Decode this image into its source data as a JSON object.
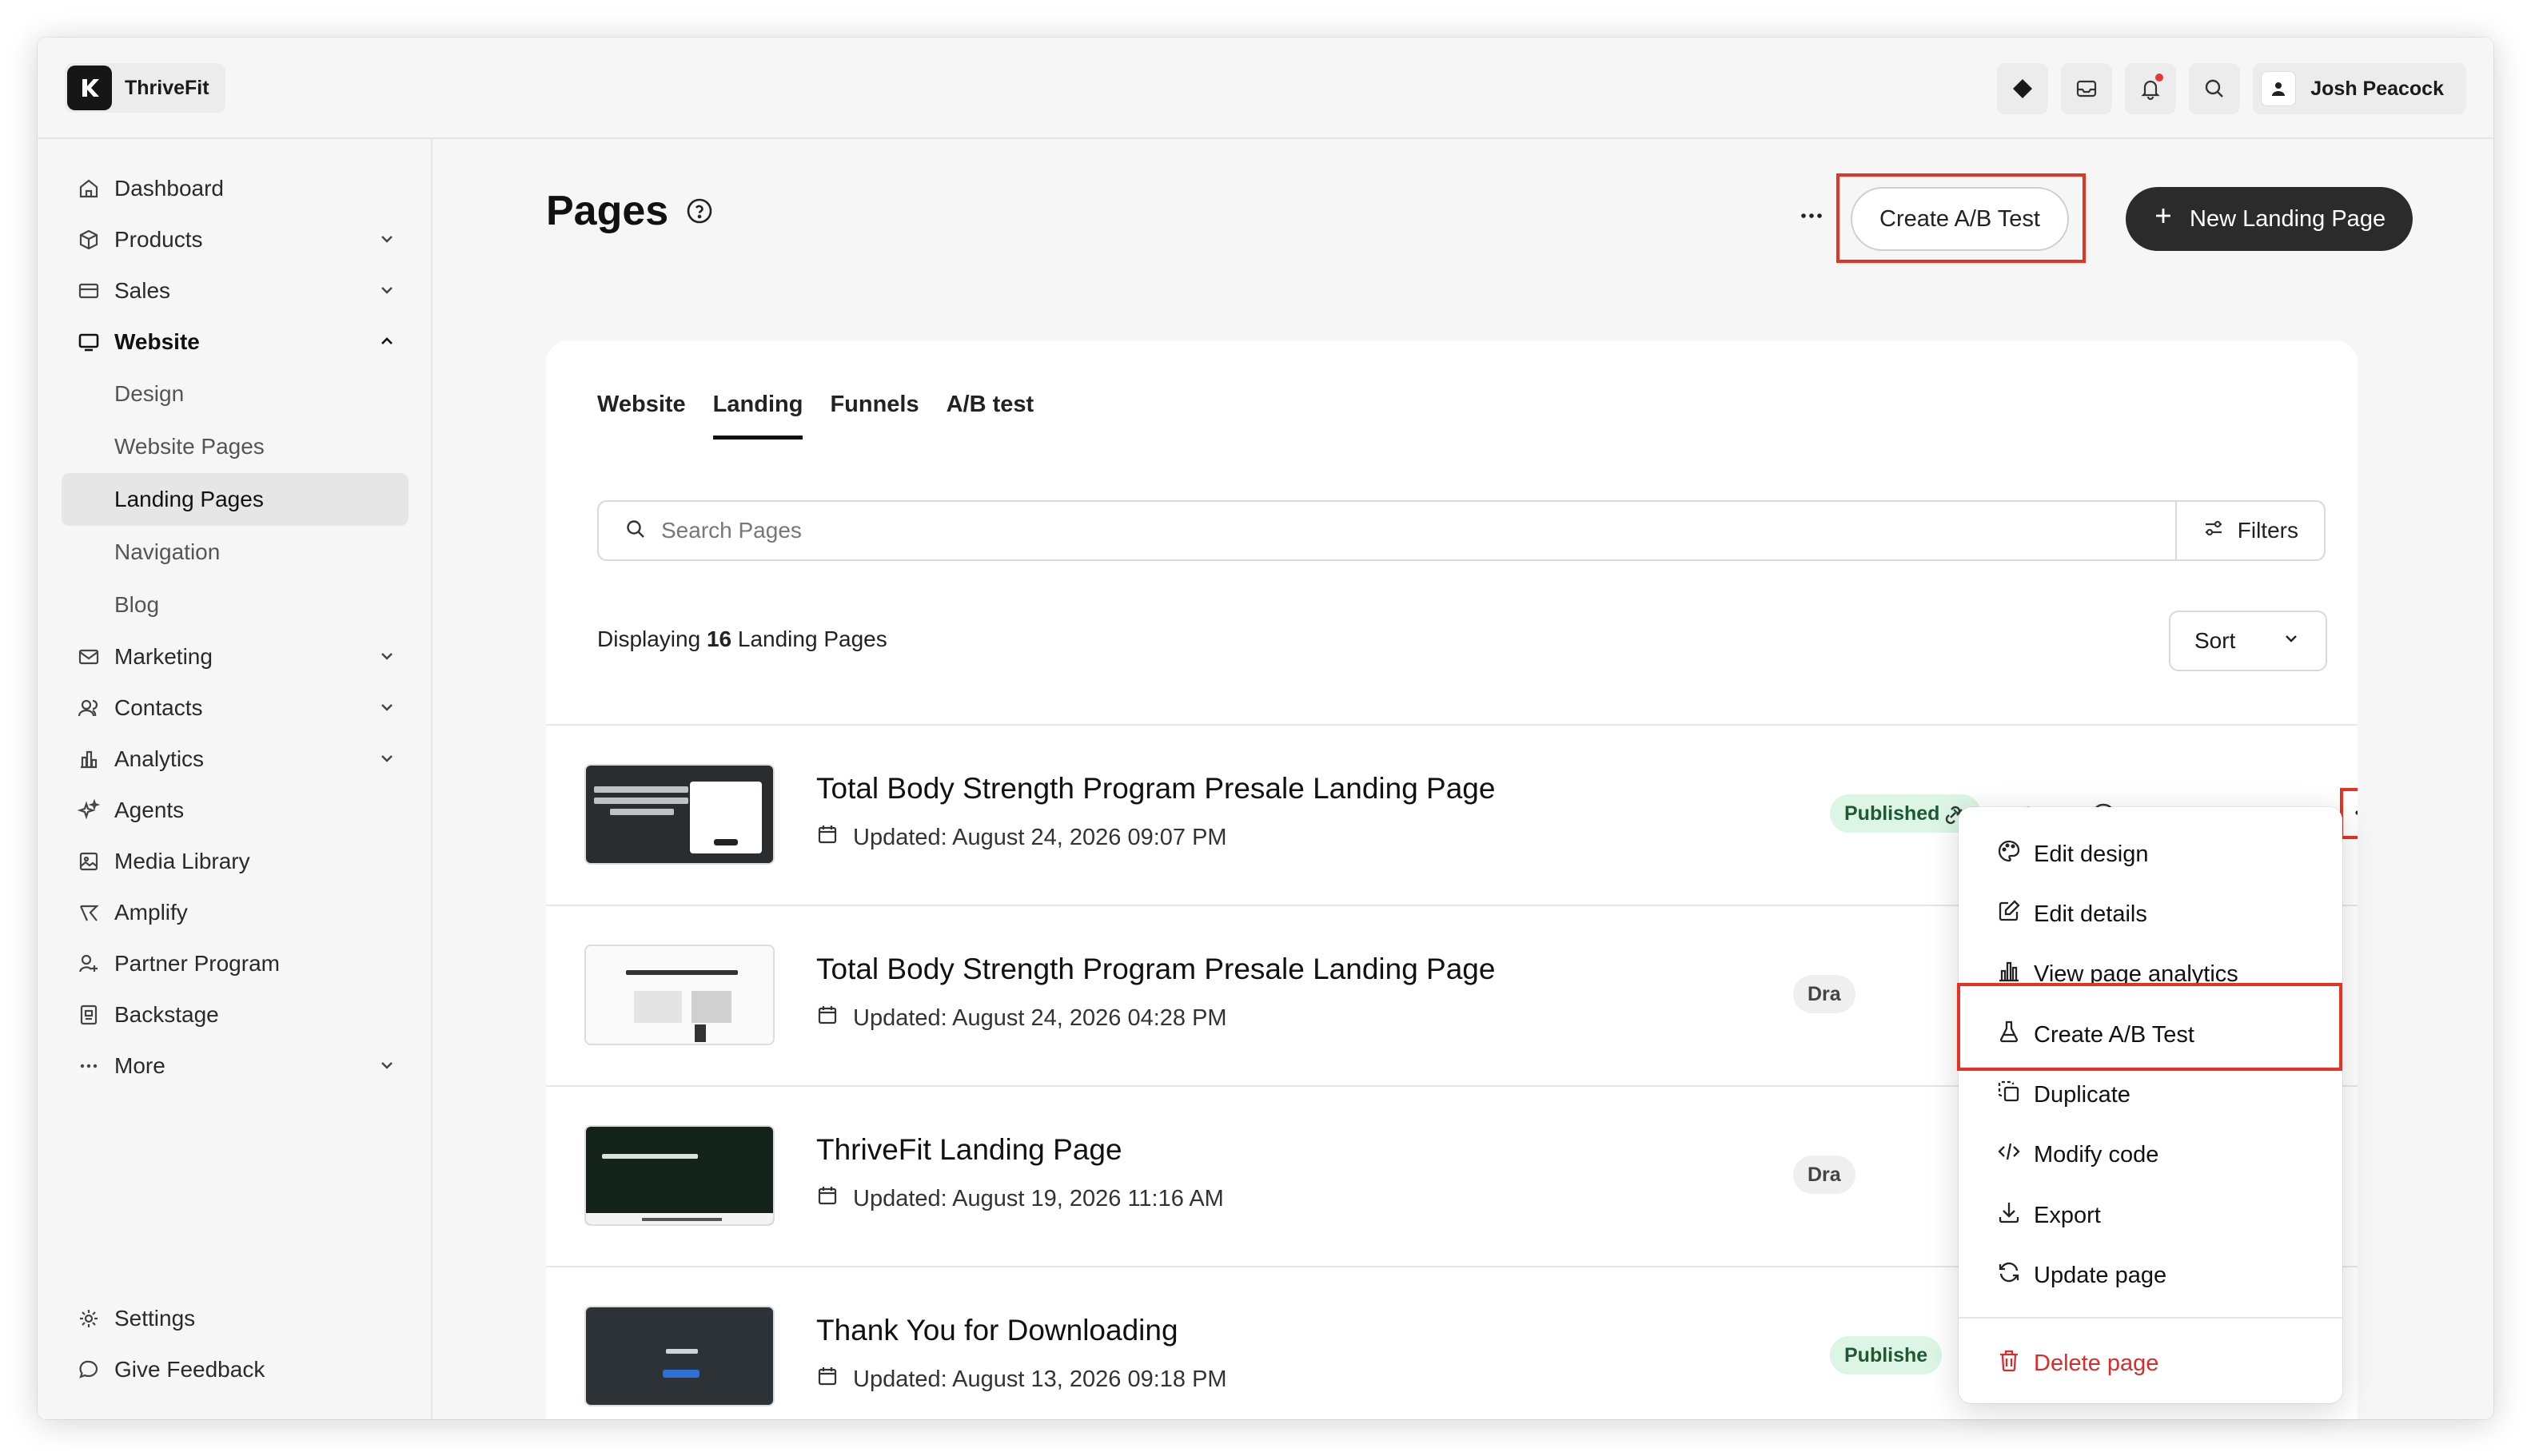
{
  "app": {
    "name": "ThriveFit",
    "user": "Josh Peacock"
  },
  "sidebar": {
    "items": [
      {
        "label": "Dashboard",
        "icon": "home-icon"
      },
      {
        "label": "Products",
        "icon": "box-icon"
      },
      {
        "label": "Sales",
        "icon": "card-icon"
      },
      {
        "label": "Website",
        "icon": "monitor-icon"
      },
      {
        "label": "Marketing",
        "icon": "mail-icon"
      },
      {
        "label": "Contacts",
        "icon": "users-icon"
      },
      {
        "label": "Analytics",
        "icon": "chart-icon"
      },
      {
        "label": "Agents",
        "icon": "sparkle-icon"
      },
      {
        "label": "Media Library",
        "icon": "image-icon"
      },
      {
        "label": "Amplify",
        "icon": "amplify-icon"
      },
      {
        "label": "Partner Program",
        "icon": "partner-icon"
      },
      {
        "label": "Backstage",
        "icon": "backstage-icon"
      },
      {
        "label": "More",
        "icon": "dots-icon"
      }
    ],
    "website_sub": [
      "Design",
      "Website Pages",
      "Landing Pages",
      "Navigation",
      "Blog"
    ],
    "bottom": [
      {
        "label": "Settings",
        "icon": "gear-icon"
      },
      {
        "label": "Give Feedback",
        "icon": "chat-icon"
      }
    ]
  },
  "header": {
    "title": "Pages",
    "ab_button": "Create A/B Test",
    "new_button": "New Landing Page"
  },
  "tabs": [
    "Website",
    "Landing",
    "Funnels",
    "A/B test"
  ],
  "search": {
    "placeholder": "Search Pages",
    "filters_label": "Filters"
  },
  "listing": {
    "prefix": "Displaying",
    "count": "16",
    "suffix": "Landing Pages",
    "sort_label": "Sort"
  },
  "rows": [
    {
      "title": "Total Body Strength Program Presale Landing Page",
      "updated": "Updated: August 24, 2026 09:07 PM",
      "status": "Published"
    },
    {
      "title": "Total Body Strength Program Presale Landing Page",
      "updated": "Updated: August 24, 2026 04:28 PM",
      "status": "Dra"
    },
    {
      "title": "ThriveFit Landing Page",
      "updated": "Updated: August 19, 2026 11:16 AM",
      "status": "Dra"
    },
    {
      "title": "Thank You for Downloading",
      "updated": "Updated: August 13, 2026 09:18 PM",
      "status": "Publishe"
    }
  ],
  "menu": [
    {
      "label": "Edit design",
      "icon": "palette-icon"
    },
    {
      "label": "Edit details",
      "icon": "edit-icon"
    },
    {
      "label": "View page analytics",
      "icon": "bar-chart-icon"
    },
    {
      "label": "Create A/B Test",
      "icon": "flask-icon"
    },
    {
      "label": "Duplicate",
      "icon": "duplicate-icon"
    },
    {
      "label": "Modify code",
      "icon": "code-icon"
    },
    {
      "label": "Export",
      "icon": "download-icon"
    },
    {
      "label": "Update page",
      "icon": "refresh-icon"
    },
    {
      "label": "Delete page",
      "icon": "trash-icon"
    }
  ],
  "colors": {
    "accent_red": "#e53323",
    "published_bg": "#dcf5e4",
    "dark_button": "#2b2b2b"
  }
}
